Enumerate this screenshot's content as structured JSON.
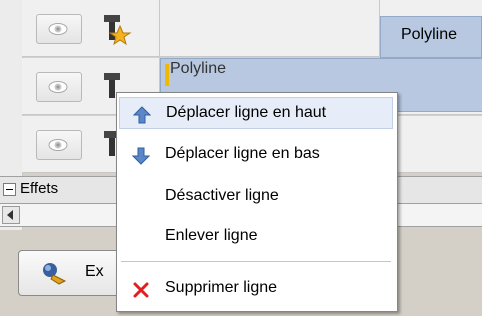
{
  "grid": {
    "row1_cell": "Polyline",
    "row2_cell": "Polyline"
  },
  "panel": {
    "effects_label": "Effets",
    "button_label": "Ex"
  },
  "context_menu": {
    "items": [
      {
        "label": "Déplacer ligne en haut",
        "icon": "arrow-up-icon"
      },
      {
        "label": "Déplacer ligne en bas",
        "icon": "arrow-down-icon"
      },
      {
        "label": "Désactiver ligne",
        "icon": ""
      },
      {
        "label": "Enlever ligne",
        "icon": ""
      },
      {
        "label": "Supprimer ligne",
        "icon": "red-x-icon"
      }
    ]
  },
  "colors": {
    "accent": "#b8c8e0",
    "menu_hover": "#e6edf8",
    "delete_red": "#e02020"
  }
}
